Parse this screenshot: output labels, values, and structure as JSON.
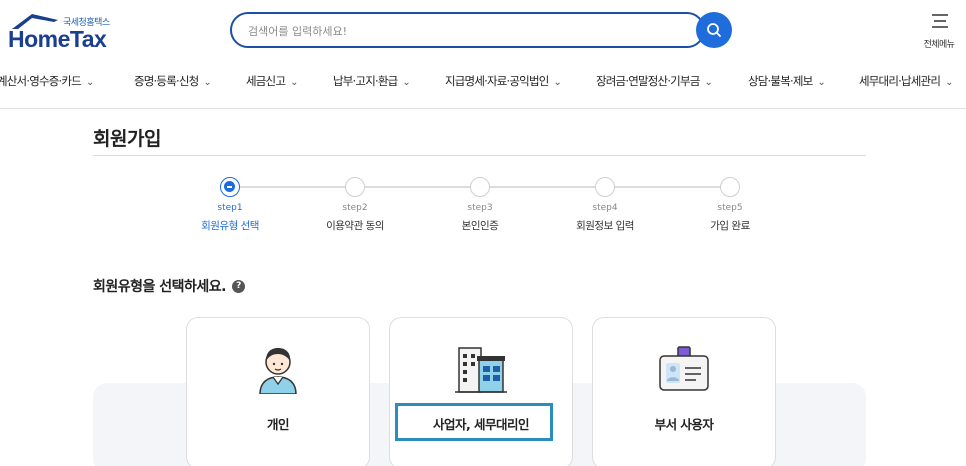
{
  "header": {
    "logo_sub": "국세청홈택스",
    "logo_main": "HomeTax",
    "search_placeholder": "검색어를 입력하세요!",
    "all_menu_label": "전체메뉴"
  },
  "nav": {
    "items": [
      {
        "label": "계산서·영수증·카드"
      },
      {
        "label": "증명·등록·신청"
      },
      {
        "label": "세금신고"
      },
      {
        "label": "납부·고지·환급"
      },
      {
        "label": "지급명세·자료·공익법인"
      },
      {
        "label": "장려금·연말정산·기부금"
      },
      {
        "label": "상담·불복·제보"
      },
      {
        "label": "세무대리·납세관리"
      }
    ]
  },
  "page": {
    "title": "회원가입",
    "subtitle": "회원유형을 선택하세요.",
    "help": "?"
  },
  "steps": [
    {
      "num": "step1",
      "label": "회원유형 선택",
      "active": true
    },
    {
      "num": "step2",
      "label": "이용약관 동의",
      "active": false
    },
    {
      "num": "step3",
      "label": "본인인증",
      "active": false
    },
    {
      "num": "step4",
      "label": "회원정보 입력",
      "active": false
    },
    {
      "num": "step5",
      "label": "가입 완료",
      "active": false
    }
  ],
  "cards": [
    {
      "label": "개인",
      "icon": "person-icon"
    },
    {
      "label": "사업자, 세무대리인",
      "icon": "building-icon",
      "selected": true
    },
    {
      "label": "부서 사용자",
      "icon": "id-badge-icon"
    }
  ],
  "colors": {
    "brand": "#1b3f8f",
    "accent": "#1f6cdc",
    "selected_border": "#2b8dbd"
  }
}
